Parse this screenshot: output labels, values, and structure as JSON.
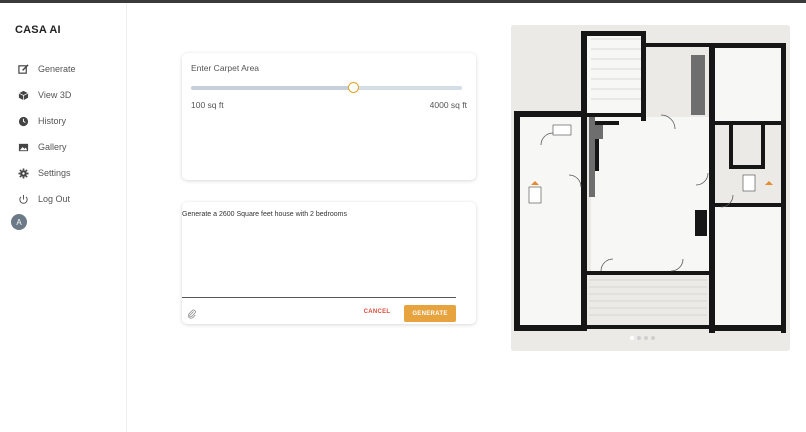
{
  "app": {
    "title": "CASA AI"
  },
  "sidebar": {
    "items": [
      {
        "label": "Generate",
        "icon": "edit-icon"
      },
      {
        "label": "View 3D",
        "icon": "cube-icon"
      },
      {
        "label": "History",
        "icon": "clock-icon"
      },
      {
        "label": "Gallery",
        "icon": "image-icon"
      },
      {
        "label": "Settings",
        "icon": "gear-icon"
      },
      {
        "label": "Log Out",
        "icon": "power-icon"
      }
    ],
    "avatar_initial": "A"
  },
  "area_card": {
    "title": "Enter Carpet Area",
    "min_label": "100 sq ft",
    "max_label": "4000 sq ft",
    "slider_fraction": 0.6
  },
  "prompt_card": {
    "text": "Generate a 2600 Square feet house with 2 bedrooms",
    "cancel_label": "CANCEL",
    "generate_label": "GENERATE"
  },
  "carousel": {
    "slide_count": 4,
    "active_index": 0
  },
  "colors": {
    "accent": "#e6a33e",
    "cancel": "#d94c3a",
    "slider_thumb": "#e3a32a",
    "track": "#d5dde6"
  }
}
